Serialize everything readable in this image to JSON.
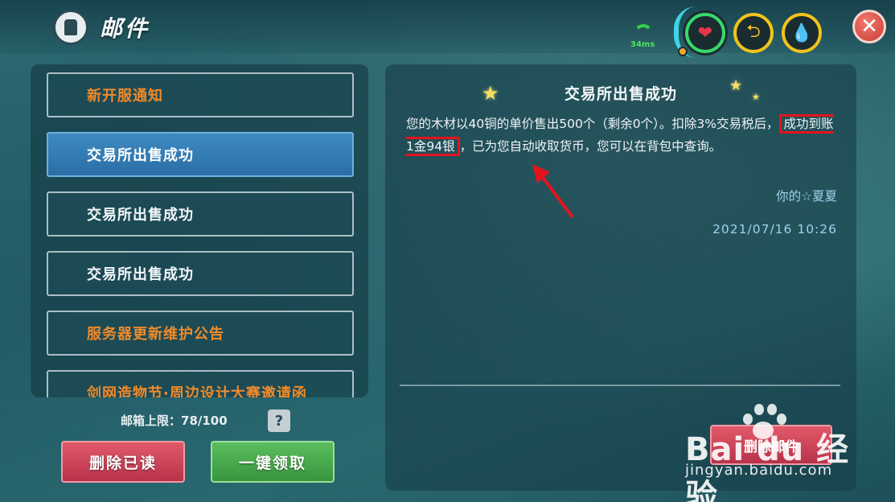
{
  "header": {
    "title": "邮件",
    "ping": "34ms"
  },
  "mail_list": [
    {
      "label": "新开服通知",
      "color": "orange",
      "selected": false
    },
    {
      "label": "交易所出售成功",
      "color": "white",
      "selected": true
    },
    {
      "label": "交易所出售成功",
      "color": "white",
      "selected": false
    },
    {
      "label": "交易所出售成功",
      "color": "white",
      "selected": false
    },
    {
      "label": "服务器更新维护公告",
      "color": "orange",
      "selected": false
    },
    {
      "label": "剑网造物节·周边设计大赛邀请函",
      "color": "orange",
      "selected": false
    }
  ],
  "mailbox_limit": "邮箱上限：78/100",
  "help_label": "?",
  "buttons": {
    "delete_read": "删除已读",
    "claim_all": "一键领取",
    "delete_mail": "删除邮件"
  },
  "mail": {
    "title": "交易所出售成功",
    "body_before": "您的木材以40铜的单价售出500个（剩余0个）。扣除3%交易税后，",
    "body_highlight": "成功到账1金94银",
    "body_after": "，已为您自动收取货币，您可以在背包中查询。",
    "sender": "你的☆夏夏",
    "date": "2021/07/16 10:26"
  },
  "watermark": {
    "logo": "Bai du 经验",
    "url": "jingyan.baidu.com"
  },
  "colors": {
    "accent_orange": "#f08a2a",
    "selected_blue": "#2b6ea7",
    "highlight_red": "#e3141c",
    "sender_blue": "#9ed2ec"
  }
}
